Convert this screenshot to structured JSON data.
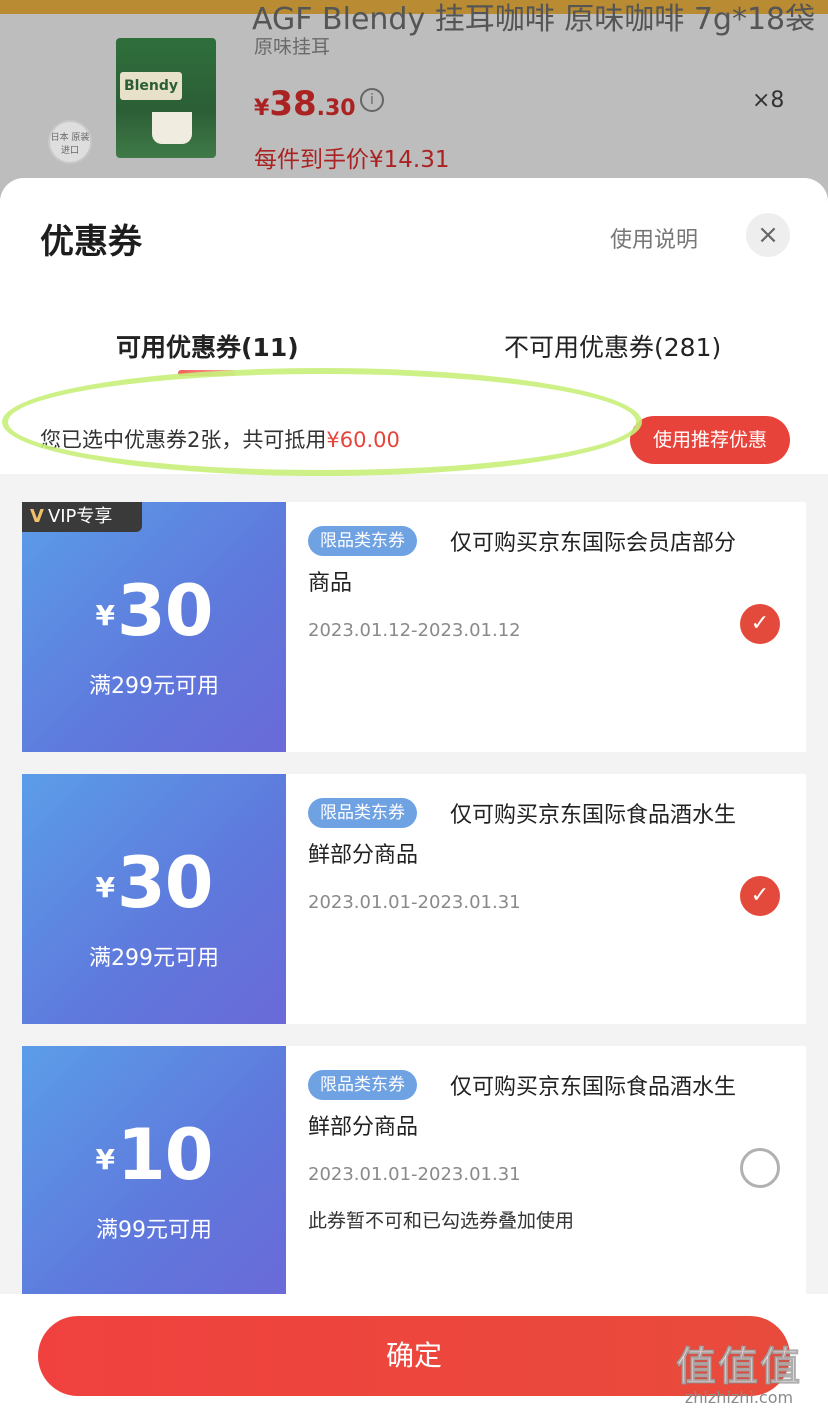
{
  "background_product": {
    "title": "AGF Blendy 挂耳咖啡 原味咖啡 7g*18袋",
    "variant": "原味挂耳",
    "brand_text": "Blendy",
    "origin_badge": "日本 原装进口",
    "price_yen": "¥",
    "price_int": "38",
    "price_dec": ".30",
    "info_icon": "i",
    "quantity": "×8",
    "per_unit_price": "每件到手价¥14.31"
  },
  "sheet": {
    "title": "优惠券",
    "help_link": "使用说明",
    "close_icon": "×",
    "tabs": [
      {
        "label": "可用优惠券(11)",
        "active": true
      },
      {
        "label": "不可用优惠券(281)",
        "active": false
      }
    ],
    "summary": {
      "text": "您已选中优惠券2张，共可抵用",
      "amount": "¥60.00"
    },
    "recommend_button": "使用推荐优惠"
  },
  "coupons": [
    {
      "badge": "VIP专享",
      "badge_icon": "V",
      "yen": "¥",
      "amount": "30",
      "threshold": "满299元可用",
      "tag": "限品类东券",
      "description": "仅可购买京东国际会员店部分商品",
      "date": "2023.01.12-2023.01.12",
      "note": "",
      "selected": true,
      "check_icon": "✓"
    },
    {
      "yen": "¥",
      "amount": "30",
      "threshold": "满299元可用",
      "tag": "限品类东券",
      "description": "仅可购买京东国际食品酒水生鲜部分商品",
      "date": "2023.01.01-2023.01.31",
      "note": "",
      "selected": true,
      "check_icon": "✓"
    },
    {
      "yen": "¥",
      "amount": "10",
      "threshold": "满99元可用",
      "tag": "限品类东券",
      "description": "仅可购买京东国际食品酒水生鲜部分商品",
      "date": "2023.01.01-2023.01.31",
      "note": "此券暂不可和已勾选券叠加使用",
      "selected": false
    }
  ],
  "footer": {
    "confirm_button": "确定",
    "watermark_main": "值值值",
    "watermark_sub": "zhizhizhi.com"
  },
  "colors": {
    "accent_red": "#e8433b",
    "coupon_blue": "#5f78dc",
    "tag_blue": "#6fa2e2"
  }
}
